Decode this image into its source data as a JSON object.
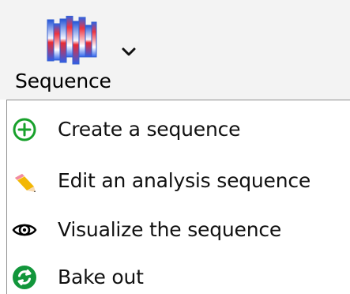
{
  "toolbar": {
    "sequence_button": {
      "label": "Sequence",
      "icon": "sequence-bars-icon",
      "dropdown_icon": "chevron-down-icon"
    }
  },
  "menu": {
    "items": [
      {
        "label": "Create a sequence",
        "icon": "add-circle-icon",
        "icon_color": "#18a12b"
      },
      {
        "label": "Edit an analysis sequence",
        "icon": "pencil-icon",
        "icon_color": "#f2b705"
      },
      {
        "label": "Visualize the sequence",
        "icon": "eye-icon",
        "icon_color": "#000000"
      },
      {
        "label": "Bake out",
        "icon": "refresh-circle-icon",
        "icon_color": "#12963b"
      }
    ]
  }
}
